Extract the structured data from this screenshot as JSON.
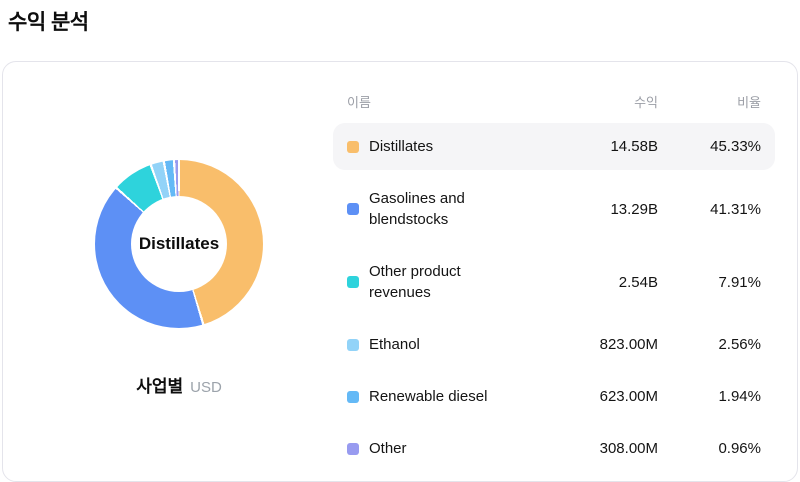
{
  "page": {
    "title": "수익 분석"
  },
  "table": {
    "headers": {
      "name": "이름",
      "revenue": "수익",
      "ratio": "비율"
    }
  },
  "chart": {
    "caption": "사업별",
    "currency": "USD"
  },
  "colors": {
    "card_border": "#e4e4eb",
    "selected_row_bg": "#f5f5f7",
    "header_text": "#9b9ea6",
    "text_primary": "#141414"
  },
  "chart_data": {
    "type": "pie",
    "donut": true,
    "title": "수익 분석",
    "center_label": "Distillates",
    "legend_position": "right",
    "unit": "USD",
    "grouping_label": "사업별",
    "categories": [
      "Distillates",
      "Gasolines and blendstocks",
      "Other product revenues",
      "Ethanol",
      "Renewable diesel",
      "Other"
    ],
    "series": [
      {
        "label": "Distillates",
        "revenue": "14.58B",
        "percent": 45.33,
        "percent_label": "45.33%",
        "color": "#F9BE6B",
        "selected": true
      },
      {
        "label": "Gasolines and blendstocks",
        "revenue": "13.29B",
        "percent": 41.31,
        "percent_label": "41.31%",
        "color": "#5D90F5",
        "selected": false
      },
      {
        "label": "Other product revenues",
        "revenue": "2.54B",
        "percent": 7.91,
        "percent_label": "7.91%",
        "color": "#2ED3DC",
        "selected": false
      },
      {
        "label": "Ethanol",
        "revenue": "823.00M",
        "percent": 2.56,
        "percent_label": "2.56%",
        "color": "#92D3F8",
        "selected": false
      },
      {
        "label": "Renewable diesel",
        "revenue": "623.00M",
        "percent": 1.94,
        "percent_label": "1.94%",
        "color": "#64B9F6",
        "selected": false
      },
      {
        "label": "Other",
        "revenue": "308.00M",
        "percent": 0.96,
        "percent_label": "0.96%",
        "color": "#989BF0",
        "selected": false
      }
    ]
  }
}
